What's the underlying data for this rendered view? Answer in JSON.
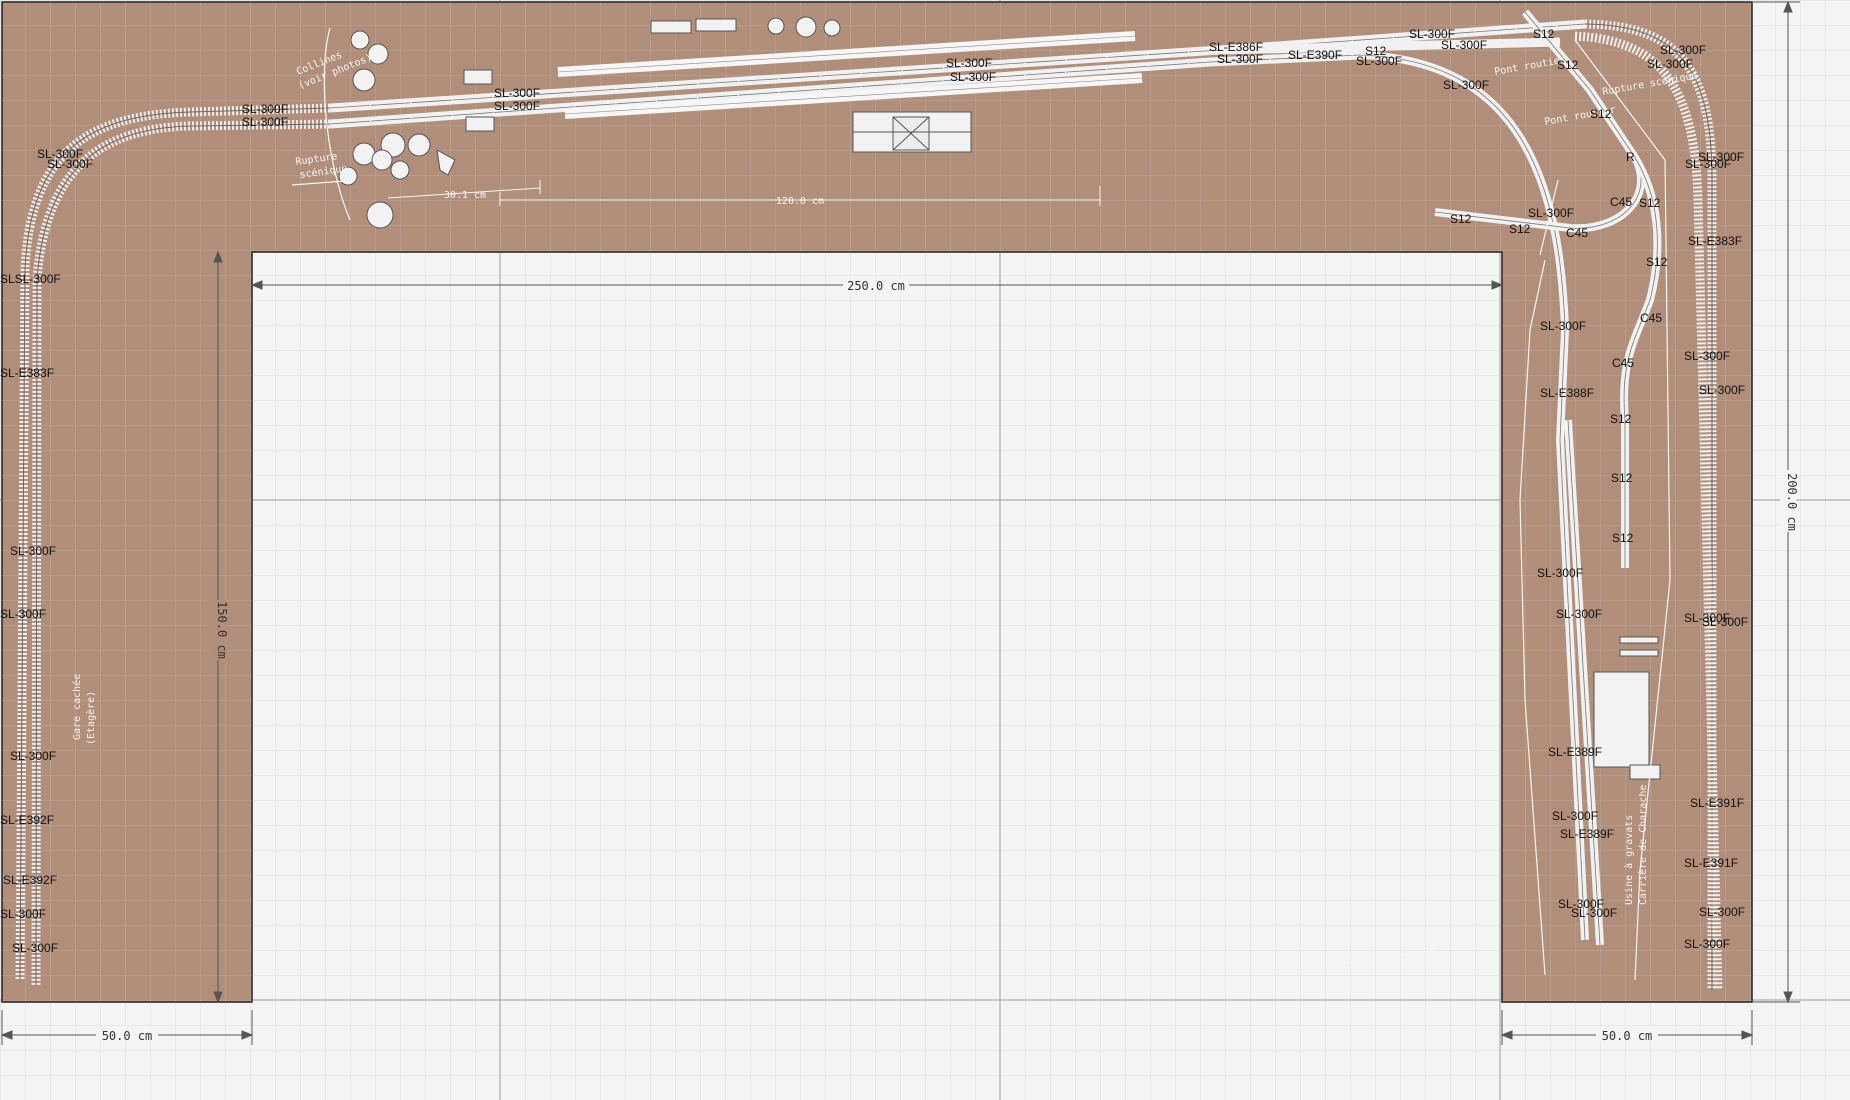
{
  "colors": {
    "board": "#b08e7a",
    "floor": "#f4f4f4",
    "grid": "#dddddd",
    "major_grid": "#9a9a9a",
    "dim": "#555555",
    "annot": "#ffffff",
    "track_label": "#111111"
  },
  "dimensions": {
    "main_width": "250.0 cm",
    "inner_depth": "150.0 cm",
    "total_depth": "200.0 cm",
    "left_width": "50.0 cm",
    "right_width": "50.0 cm",
    "station_len": "120.0 cm",
    "lead_len": "30.1 cm"
  },
  "annotations": {
    "collines_1": "Collines",
    "collines_2": "(voir photos)",
    "rupture_1": "Rupture",
    "rupture_2": "scénique",
    "rupture_right": "Rupture scénique",
    "pont_1": "Pont routier",
    "pont_2": "Pont routier",
    "gare_1": "Gare cachée",
    "gare_2": "(Etagère)",
    "usine_1": "Usine à gravats",
    "usine_2": "Carrière de Charache"
  },
  "track_labels": {
    "top_1": "SL-300F",
    "top_2": "SL-300F",
    "top_3": "SL-300F",
    "top_4": "SL-300F",
    "top_5": "SL-300F",
    "top_6": "SL-300F",
    "top_7": "SL-E386F",
    "top_8": "SL-300F",
    "top_9": "SL-E390F",
    "top_10": "SL-300F",
    "top_11": "SL-300F",
    "top_12": "SL-300F",
    "top_13": "SL-300F",
    "left_1": "SL-300F",
    "left_2": "SL-300F",
    "left_3": "SLSL-300F",
    "left_4": "SL-E383F",
    "left_5": "SL-300F",
    "left_6": "SL-300F",
    "left_7": "SL-300F",
    "left_8": "SL-E392F",
    "left_9": "SL-E392F",
    "left_10": "SL-300F",
    "left_11": "SL-300F",
    "mid_1": "SL-300F",
    "mid_2": "SL-300F",
    "mid_3": "SL-E388F",
    "mid_4": "SL-300F",
    "mid_5": "SL-300F",
    "mid_6": "SL-E389F",
    "mid_7": "SL-300F",
    "mid_8": "SL-E389F",
    "mid_9": "SL-300F",
    "mid_10": "SL-300F",
    "right_1": "SL-300F",
    "right_2": "SL-300F",
    "right_3": "SL-300F",
    "right_4": "SL-300F",
    "right_5": "SL-E383F",
    "right_6": "SL-300F",
    "right_7": "SL-300F",
    "right_8": "SL-300F",
    "right_9": "SL-300F",
    "right_10": "SL-E391F",
    "right_11": "SL-E391F",
    "right_12": "SL-300F",
    "right_13": "SL-300F",
    "s12_1": "S12",
    "s12_2": "S12",
    "s12_3": "S12",
    "s12_4": "R",
    "s12_5": "S12",
    "s12_6": "S12",
    "s12_7": "S12",
    "s12_8": "S12",
    "s12_9": "S12",
    "s12_10": "S12",
    "s12_11": "S12",
    "s12_12": "S12",
    "c45_1": "C45",
    "c45_2": "C45",
    "c45_3": "C45",
    "c45_4": "C45"
  }
}
